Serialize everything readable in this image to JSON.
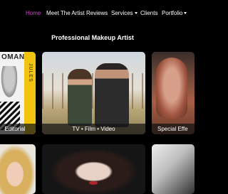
{
  "nav": {
    "home": "Home",
    "meet_the_artist": "Meet The Artist",
    "reviews": "Reviews",
    "services": "Services",
    "clients": "Clients",
    "portfolio": "Portfolio",
    "active_color": "#d63fd0"
  },
  "heading": "Professional Makeup Artist",
  "cards": {
    "editorial": {
      "label": "Editorial",
      "magazine_text": "OMAN",
      "vertical_text": "JULES"
    },
    "tv": {
      "label": "TV • Film • Video"
    },
    "sfx": {
      "label": "Special Effe"
    }
  },
  "colors": {
    "accent_yellow": "#f1c40f",
    "background": "#000000"
  }
}
